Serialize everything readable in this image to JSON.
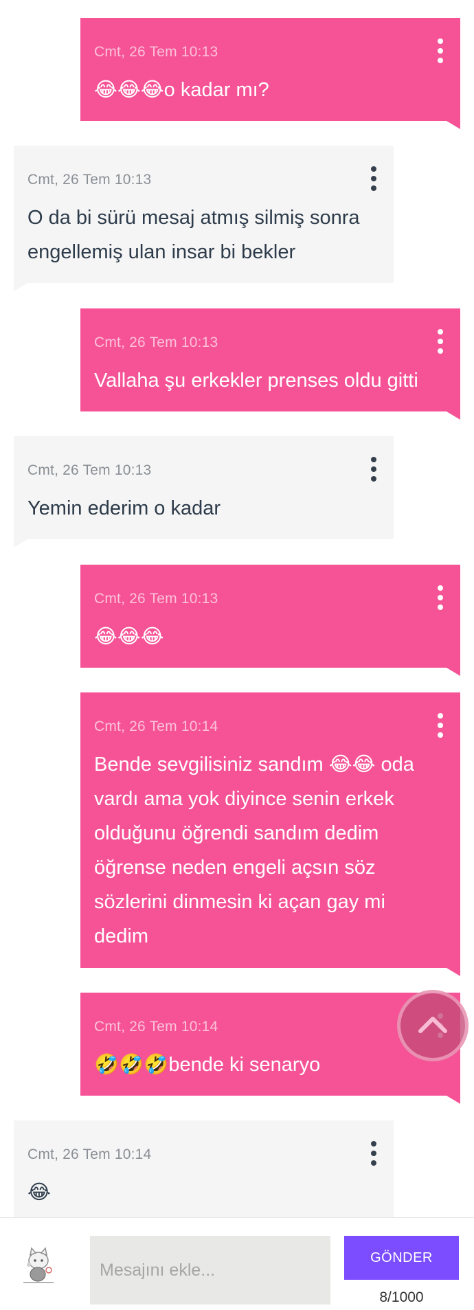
{
  "messages": [
    {
      "direction": "out",
      "time": "Cmt, 26 Tem 10:13",
      "text": "😂😂😂o kadar mı?"
    },
    {
      "direction": "in",
      "time": "Cmt, 26 Tem 10:13",
      "text": "O da bi sürü mesaj atmış silmiş sonra\nengellemiş ulan insar bi bekler"
    },
    {
      "direction": "out",
      "time": "Cmt, 26 Tem 10:13",
      "text": "Vallaha şu erkekler prenses oldu gitti"
    },
    {
      "direction": "in",
      "time": "Cmt, 26 Tem 10:13",
      "text": "Yemin ederim o kadar"
    },
    {
      "direction": "out",
      "time": "Cmt, 26 Tem 10:13",
      "text": "😂😂😂"
    },
    {
      "direction": "out",
      "time": "Cmt, 26 Tem 10:14",
      "text": "Bende sevgilisiniz sandım 😂😂 oda\nvardı ama yok diyince senin erkek\nolduğunu öğrendi sandım dedim\nöğrense neden engeli açsın söz\nsözlerini dinmesin ki açan gay mi\ndedim"
    },
    {
      "direction": "out",
      "time": "Cmt, 26 Tem 10:14",
      "text": "🤣🤣🤣bende ki senaryo"
    },
    {
      "direction": "in",
      "time": "Cmt, 26 Tem 10:14",
      "text": "😂"
    }
  ],
  "composer": {
    "placeholder": "Mesajını ekle...",
    "send_label": "GÖNDER",
    "counter": "8/1000"
  },
  "icons": {
    "message_menu": "more-vertical-icon",
    "scroll_top": "chevron-up-icon",
    "avatar": "cat-sticker-avatar"
  },
  "colors": {
    "outgoing_bubble": "#f65397",
    "incoming_bubble": "#f5f5f5",
    "send_button": "#7b4dff"
  }
}
